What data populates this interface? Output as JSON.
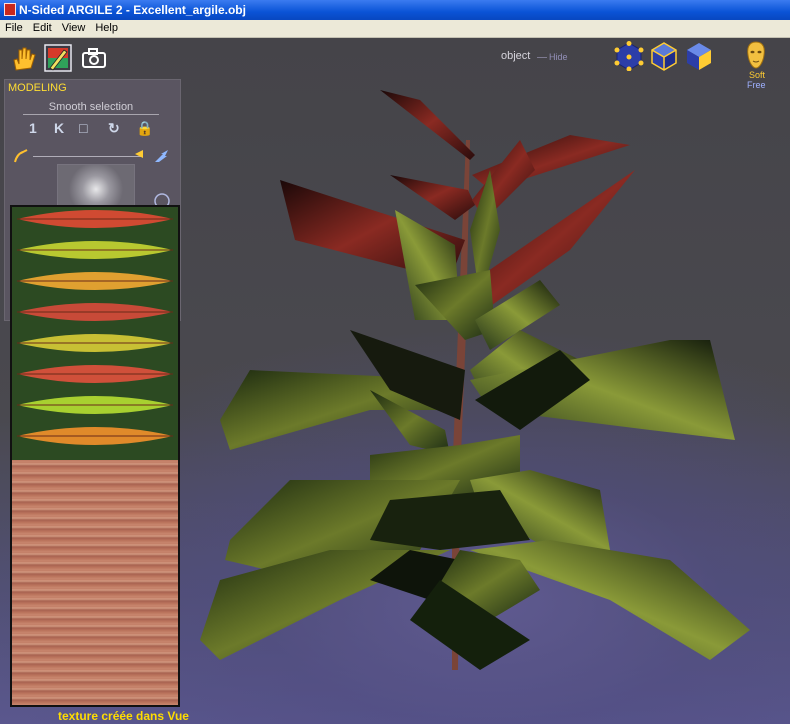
{
  "window": {
    "title": "N-Sided ARGILE 2 - Excellent_argile.obj"
  },
  "menu": [
    "File",
    "Edit",
    "View",
    "Help"
  ],
  "toolbar": {
    "icons": [
      "hand-icon",
      "paint-brush-icon",
      "camera-icon"
    ]
  },
  "panel": {
    "mode_label": "MODELING",
    "smooth_label": "Smooth selection",
    "selection_icons": [
      "1",
      "K",
      "□",
      "↻",
      "🔒"
    ]
  },
  "viewport": {
    "object_label": "object",
    "hide_label": "Hide",
    "soft_label": "Soft",
    "free_label": "Free"
  },
  "caption": "texture créée dans Vue",
  "colors": {
    "titlebar": "#0a53d6",
    "accent_yellow": "#ffdd33"
  }
}
